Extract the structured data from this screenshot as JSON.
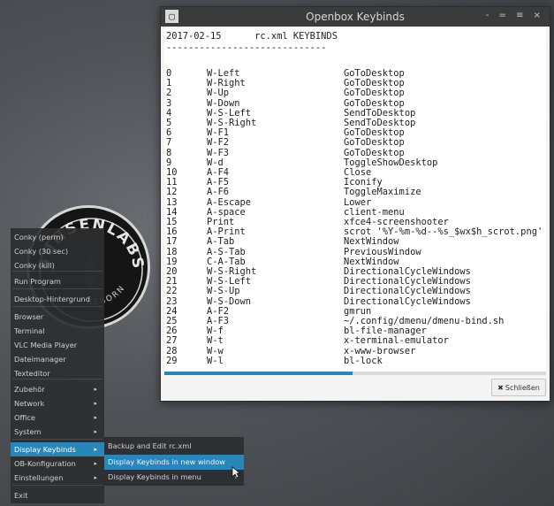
{
  "window": {
    "title": "Openbox Keybinds",
    "icon_glyph": "▢",
    "controls": "- = ≡ ×",
    "header_date": "2017-02-15",
    "header_title": "rc.xml KEYBINDS",
    "header_rule": "-----------------------------",
    "rows": [
      {
        "num": "0",
        "key": "W-Left",
        "action": "GoToDesktop"
      },
      {
        "num": "1",
        "key": "W-Right",
        "action": "GoToDesktop"
      },
      {
        "num": "2",
        "key": "W-Up",
        "action": "GoToDesktop"
      },
      {
        "num": "3",
        "key": "W-Down",
        "action": "GoToDesktop"
      },
      {
        "num": "4",
        "key": "W-S-Left",
        "action": "SendToDesktop"
      },
      {
        "num": "5",
        "key": "W-S-Right",
        "action": "SendToDesktop"
      },
      {
        "num": "6",
        "key": "W-F1",
        "action": "GoToDesktop"
      },
      {
        "num": "7",
        "key": "W-F2",
        "action": "GoToDesktop"
      },
      {
        "num": "8",
        "key": "W-F3",
        "action": "GoToDesktop"
      },
      {
        "num": "9",
        "key": "W-d",
        "action": "ToggleShowDesktop"
      },
      {
        "num": "10",
        "key": "A-F4",
        "action": "Close"
      },
      {
        "num": "11",
        "key": "A-F5",
        "action": "Iconify"
      },
      {
        "num": "12",
        "key": "A-F6",
        "action": "ToggleMaximize"
      },
      {
        "num": "13",
        "key": "A-Escape",
        "action": "Lower"
      },
      {
        "num": "14",
        "key": "A-space",
        "action": "client-menu"
      },
      {
        "num": "15",
        "key": "Print",
        "action": "xfce4-screenshooter"
      },
      {
        "num": "16",
        "key": "A-Print",
        "action": "scrot '%Y-%m-%d--%s_$wx$h_scrot.png'"
      },
      {
        "num": "17",
        "key": "A-Tab",
        "action": "NextWindow"
      },
      {
        "num": "18",
        "key": "A-S-Tab",
        "action": "PreviousWindow"
      },
      {
        "num": "19",
        "key": "C-A-Tab",
        "action": "NextWindow"
      },
      {
        "num": "20",
        "key": "W-S-Right",
        "action": "DirectionalCycleWindows"
      },
      {
        "num": "21",
        "key": "W-S-Left",
        "action": "DirectionalCycleWindows"
      },
      {
        "num": "22",
        "key": "W-S-Up",
        "action": "DirectionalCycleWindows"
      },
      {
        "num": "23",
        "key": "W-S-Down",
        "action": "DirectionalCycleWindows"
      },
      {
        "num": "24",
        "key": "A-F2",
        "action": "gmrun"
      },
      {
        "num": "25",
        "key": "A-F3",
        "action": "~/.config/dmenu/dmenu-bind.sh"
      },
      {
        "num": "26",
        "key": "W-f",
        "action": "bl-file-manager"
      },
      {
        "num": "27",
        "key": "W-t",
        "action": "x-terminal-emulator"
      },
      {
        "num": "28",
        "key": "W-w",
        "action": "x-www-browser"
      },
      {
        "num": "29",
        "key": "W-l",
        "action": "bl-lock"
      }
    ],
    "close_icon": "✖",
    "close_label": "Schließen"
  },
  "logo": {
    "top_text": "BUNSENLABS",
    "bottom_text": "REBORN"
  },
  "menu": {
    "items": [
      {
        "label": "Conky (perm)"
      },
      {
        "label": "Conky (30 sec)"
      },
      {
        "label": "Conky (kill)"
      },
      {
        "label": "Run Program"
      },
      {
        "label": "Desktop-Hintergrund"
      },
      {
        "label": "Browser"
      },
      {
        "label": "Terminal"
      },
      {
        "label": "VLC Media Player"
      },
      {
        "label": "Dateimanager"
      },
      {
        "label": "Texteditor"
      },
      {
        "label": "Zubehör",
        "arrow": "▸"
      },
      {
        "label": "Network",
        "arrow": "▸"
      },
      {
        "label": "Office",
        "arrow": "▸"
      },
      {
        "label": "System",
        "arrow": "▸"
      },
      {
        "label": "Display Keybinds",
        "arrow": "▸",
        "active": true
      },
      {
        "label": "OB-Konfiguration",
        "arrow": "▸"
      },
      {
        "label": "Einstellungen",
        "arrow": "▸"
      },
      {
        "label": "Exit"
      }
    ],
    "submenu": [
      {
        "label": "Backup and Edit rc.xml"
      },
      {
        "label": "Display Keybinds in new window",
        "active": true
      },
      {
        "label": "Display Keybinds in menu",
        "arrow": "▸"
      }
    ]
  },
  "colors": {
    "accent": "#2a86b8",
    "menu_bg": "#2c2e30",
    "titlebar": "#3b3b3b"
  }
}
